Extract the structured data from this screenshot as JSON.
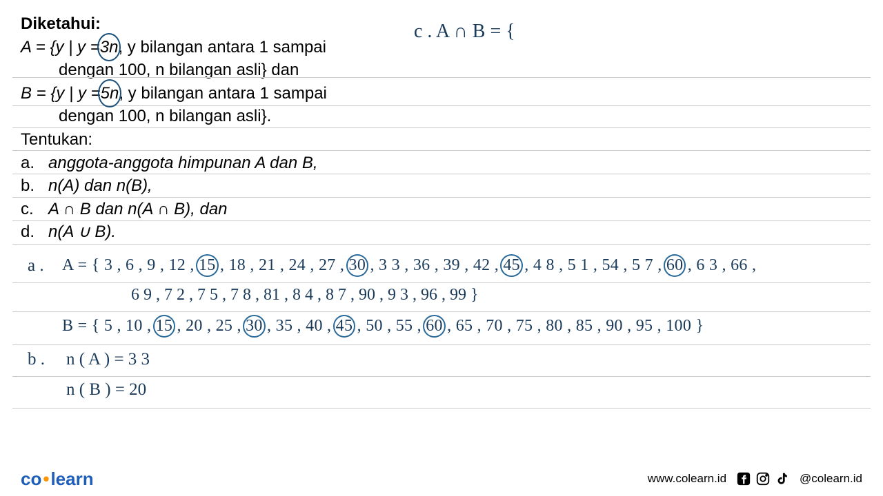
{
  "problem": {
    "title": "Diketahui:",
    "setA_line1_prefix": "A = {y | y =",
    "setA_circled": "3n",
    "setA_line1_suffix": ", y bilangan antara 1 sampai",
    "setA_line2": "dengan 100, n bilangan asli} dan",
    "setB_line1_prefix": "B = {y | y =",
    "setB_circled": "5n",
    "setB_line1_suffix": ", y bilangan antara 1 sampai",
    "setB_line2": "dengan 100, n bilangan asli}.",
    "tentukan": "Tentukan:",
    "items": [
      {
        "letter": "a.",
        "text": "anggota-anggota himpunan A dan B,"
      },
      {
        "letter": "b.",
        "text": "n(A) dan n(B),"
      },
      {
        "letter": "c.",
        "text": "A ∩ B dan n(A ∩ B), dan"
      },
      {
        "letter": "d.",
        "text": "n(A ∪ B)."
      }
    ]
  },
  "handwriting": {
    "topRight": "c .  A ∩ B = {",
    "a_label": "a .",
    "a_A_prefix": "A  =  { 3 , 6 , 9 , 12 ,",
    "a_A_c1": "15",
    "a_A_p2": ", 18 , 21 , 24 , 27 ,",
    "a_A_c2": "30",
    "a_A_p3": ", 3 3 , 36 , 39 , 42 ,",
    "a_A_c3": "45",
    "a_A_p4": ", 4 8 , 5 1 , 54 , 5 7 ,",
    "a_A_c4": "60",
    "a_A_p5": ", 6 3 , 66 ,",
    "a_A_line2": "6 9 , 7 2 , 7 5 , 7 8 , 81 , 8 4 , 8 7 , 90 , 9 3 , 96 , 99 }",
    "a_B_prefix": "B  =  { 5 , 10 ,",
    "a_B_c1": "15",
    "a_B_p2": ", 20 , 25 ,",
    "a_B_c2": "30",
    "a_B_p3": ", 35 , 40 ,",
    "a_B_c3": "45",
    "a_B_p4": ", 50 , 55 ,",
    "a_B_c4": "60",
    "a_B_p5": ", 65 , 70 , 75 , 80 , 85 , 90 , 95 , 100 }",
    "b_label": "b .",
    "b_nA": "n ( A )  =  3 3",
    "b_nB": "n ( B )  =  20"
  },
  "footer": {
    "logo_co": "co",
    "logo_learn": "learn",
    "url": "www.colearn.id",
    "handle": "@colearn.id"
  }
}
